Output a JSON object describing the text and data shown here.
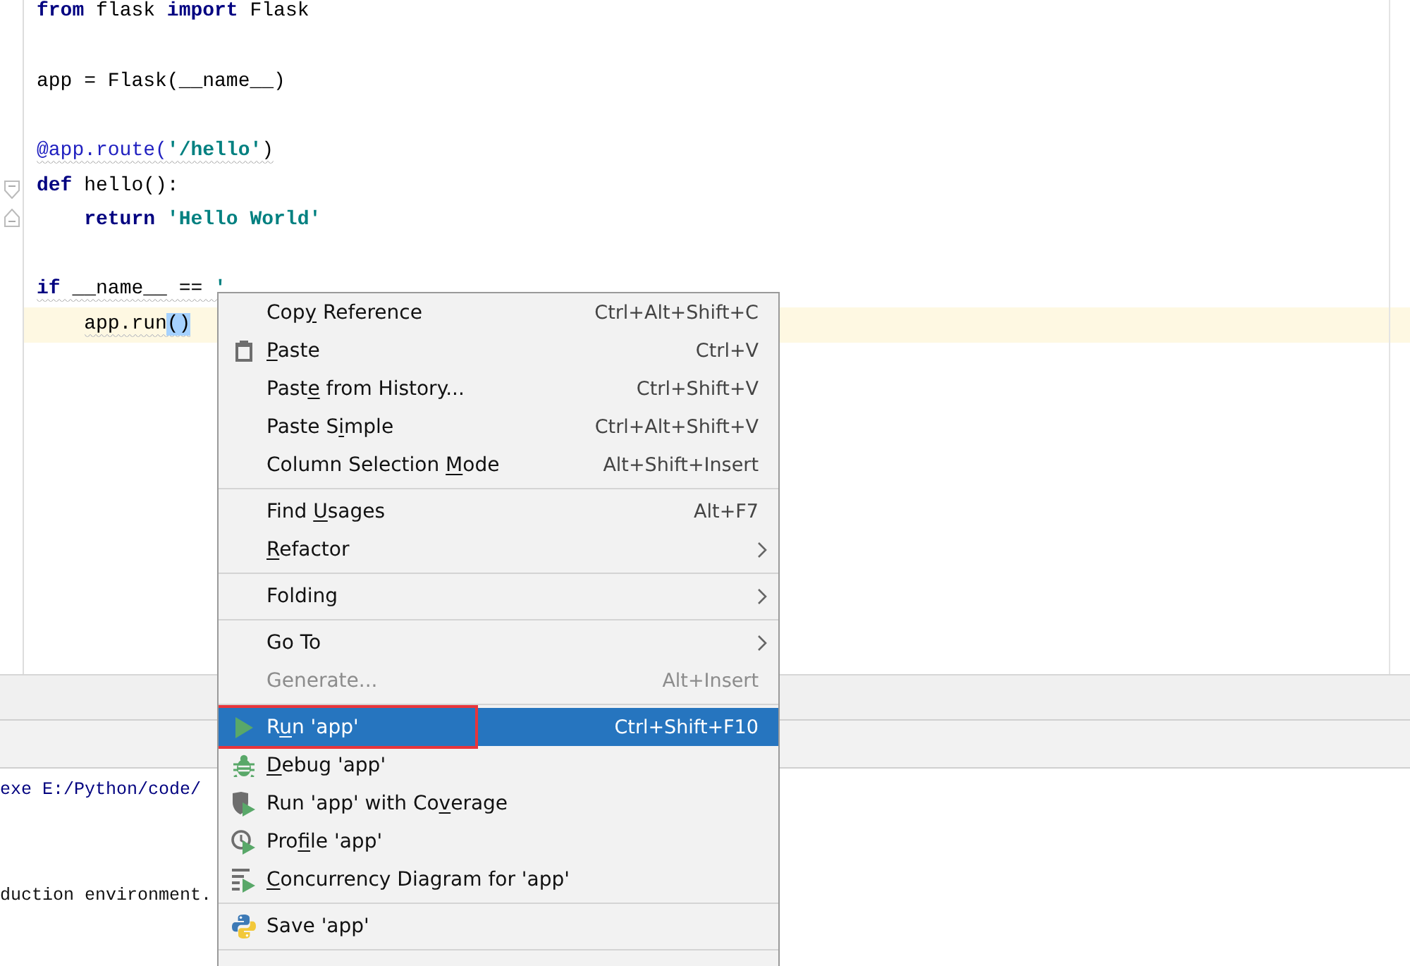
{
  "editor": {
    "lines": [
      {
        "kind": "code",
        "tokens": [
          {
            "kind": "keyword",
            "text": "from"
          },
          {
            "kind": "plain",
            "text": " flask "
          },
          {
            "kind": "keyword",
            "text": "import"
          },
          {
            "kind": "plain",
            "text": " Flask"
          }
        ]
      },
      {
        "kind": "blank"
      },
      {
        "kind": "code",
        "tokens": [
          {
            "kind": "plain",
            "text": "app = Flask(__name__)"
          }
        ]
      },
      {
        "kind": "blank"
      },
      {
        "kind": "code",
        "warning": true,
        "tokens": [
          {
            "kind": "decorator",
            "text": "@app.route("
          },
          {
            "kind": "string",
            "text": "'/hello'"
          },
          {
            "kind": "plain",
            "text": ")"
          }
        ]
      },
      {
        "kind": "code",
        "fold_open": true,
        "tokens": [
          {
            "kind": "keyword",
            "text": "def"
          },
          {
            "kind": "plain",
            "text": " hello():"
          }
        ]
      },
      {
        "kind": "code",
        "fold_close": true,
        "indented": true,
        "tokens": [
          {
            "kind": "keyword",
            "text": "return"
          },
          {
            "kind": "string",
            "text": " 'Hello World'"
          }
        ]
      },
      {
        "kind": "blank"
      },
      {
        "kind": "code",
        "warning": true,
        "tokens": [
          {
            "kind": "keyword",
            "text": "if"
          },
          {
            "kind": "plain",
            "text": " __name__ == "
          },
          {
            "kind": "string",
            "text": "'"
          }
        ]
      },
      {
        "kind": "code",
        "current": true,
        "warning": true,
        "indented": true,
        "tokens": [
          {
            "kind": "plain",
            "text": "app.run"
          },
          {
            "kind": "selected",
            "text": "()"
          }
        ]
      }
    ]
  },
  "console": {
    "lines": [
      {
        "text": "exe E:/Python/code/",
        "kind": "command"
      },
      {
        "kind": "blank"
      },
      {
        "kind": "blank"
      },
      {
        "text": "duction environment.",
        "kind": "output"
      }
    ]
  },
  "context_menu": {
    "items": [
      {
        "kind": "item",
        "pre": "Cop",
        "key": "y",
        "post": " Reference",
        "shortcut": "Ctrl+Alt+Shift+C"
      },
      {
        "kind": "item",
        "key": "P",
        "post": "aste",
        "shortcut": "Ctrl+V"
      },
      {
        "kind": "item",
        "pre": "Past",
        "key": "e",
        "post": " from History...",
        "shortcut": "Ctrl+Shift+V"
      },
      {
        "kind": "item",
        "pre": "Paste S",
        "key": "i",
        "post": "mple",
        "shortcut": "Ctrl+Alt+Shift+V"
      },
      {
        "kind": "item",
        "pre": "Column Selection ",
        "key": "M",
        "post": "ode",
        "shortcut": "Alt+Shift+Insert"
      },
      {
        "kind": "separator"
      },
      {
        "kind": "item",
        "pre": "Find ",
        "key": "U",
        "post": "sages",
        "shortcut": "Alt+F7"
      },
      {
        "kind": "item",
        "key": "R",
        "post": "efactor",
        "submenu": true
      },
      {
        "kind": "separator"
      },
      {
        "kind": "item",
        "pre": "Folding",
        "submenu": true
      },
      {
        "kind": "separator"
      },
      {
        "kind": "item",
        "pre": "Go To",
        "submenu": true
      },
      {
        "kind": "item",
        "pre": "Generate...",
        "shortcut": "Alt+Insert",
        "disabled": true
      },
      {
        "kind": "separator"
      },
      {
        "kind": "item",
        "pre": "R",
        "key": "u",
        "post": "n 'app'",
        "shortcut": "Ctrl+Shift+F10",
        "selected": true,
        "annotated": true
      },
      {
        "kind": "item",
        "key": "D",
        "post": "ebug 'app'"
      },
      {
        "kind": "item",
        "pre": "Run 'app' with Co",
        "key": "v",
        "post": "erage"
      },
      {
        "kind": "item",
        "pre": "Pro",
        "key": "f",
        "post": "ile 'app'"
      },
      {
        "kind": "item",
        "key": "C",
        "post": "oncurrency Diagram for 'app'"
      },
      {
        "kind": "separator"
      },
      {
        "kind": "item",
        "pre": "Save 'app'"
      },
      {
        "kind": "separator"
      }
    ]
  }
}
